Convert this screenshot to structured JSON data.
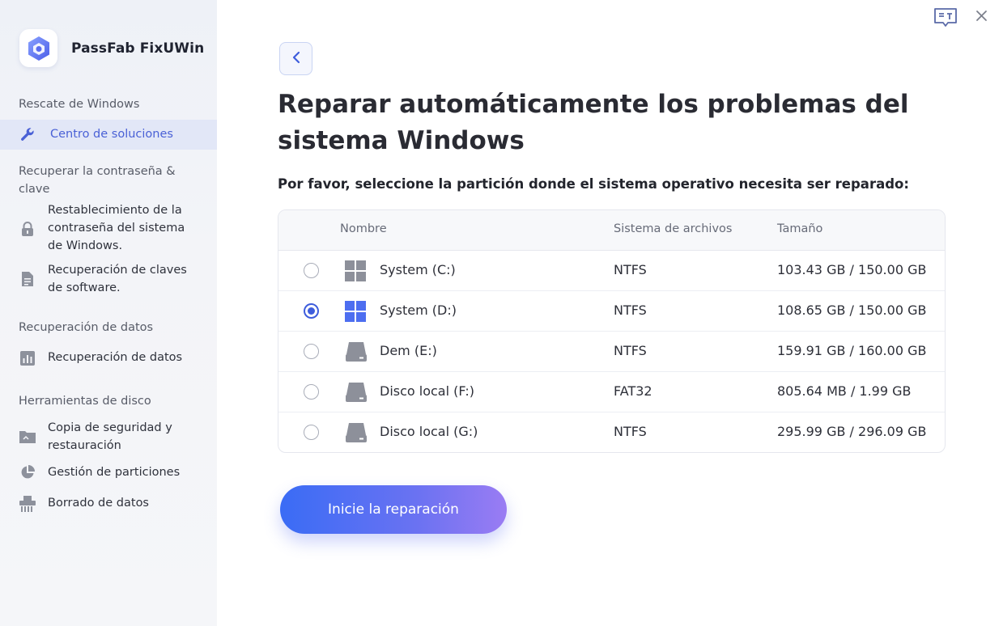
{
  "app": {
    "name": "PassFab FixUWin"
  },
  "sidebar": {
    "sections": [
      {
        "title": "Rescate de Windows"
      },
      {
        "title": "Recuperar la contraseña & clave"
      },
      {
        "title": "Recuperación de datos"
      },
      {
        "title": "Herramientas de disco"
      }
    ],
    "items": [
      {
        "label": "Centro de soluciones",
        "icon": "wrench-icon",
        "active": true
      },
      {
        "label": "Restablecimiento de la contraseña del sistema de Windows.",
        "icon": "lock-icon"
      },
      {
        "label": "Recuperación de claves de software.",
        "icon": "document-icon"
      },
      {
        "label": "Recuperación de datos",
        "icon": "bar-chart-icon"
      },
      {
        "label": "Copia de seguridad y restauración",
        "icon": "folder-icon"
      },
      {
        "label": "Gestión de particiones",
        "icon": "pie-chart-icon"
      },
      {
        "label": "Borrado de datos",
        "icon": "shredder-icon"
      }
    ]
  },
  "main": {
    "title": "Reparar automáticamente los problemas del sistema Windows",
    "subtitle": "Por favor, seleccione la partición donde el sistema operativo necesita ser reparado:",
    "table": {
      "headers": {
        "name": "Nombre",
        "fs": "Sistema de archivos",
        "size": "Tamaño"
      },
      "rows": [
        {
          "name": "System (C:)",
          "fs": "NTFS",
          "size": "103.43 GB / 150.00 GB",
          "icon": "windows-icon",
          "selected": false
        },
        {
          "name": "System (D:)",
          "fs": "NTFS",
          "size": "108.65 GB / 150.00 GB",
          "icon": "windows-icon",
          "selected": true
        },
        {
          "name": "Dem (E:)",
          "fs": "NTFS",
          "size": "159.91 GB / 160.00 GB",
          "icon": "drive-icon",
          "selected": false
        },
        {
          "name": "Disco local (F:)",
          "fs": "FAT32",
          "size": "805.64 MB / 1.99 GB",
          "icon": "drive-icon",
          "selected": false
        },
        {
          "name": "Disco local (G:)",
          "fs": "NTFS",
          "size": "295.99 GB / 296.09 GB",
          "icon": "drive-icon",
          "selected": false
        }
      ]
    },
    "start_button": "Inicie la reparación"
  },
  "colors": {
    "accent": "#3e5ddc",
    "button_start": "#3a6cf5",
    "button_end": "#9a7cf3",
    "sidebar_bg": "#f3f4f8"
  }
}
